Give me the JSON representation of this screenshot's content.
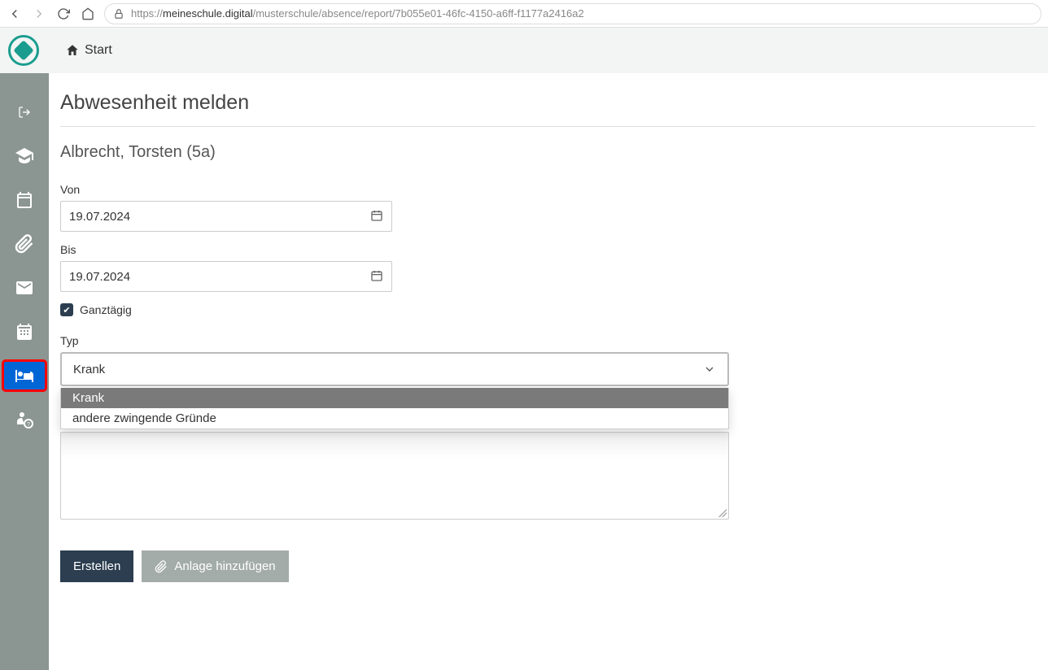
{
  "browser": {
    "url_prefix": "https://",
    "url_domain": "meineschule.digital",
    "url_path": "/musterschule/absence/report/7b055e01-46fc-4150-a6ff-f1177a2416a2"
  },
  "header": {
    "start": "Start"
  },
  "page": {
    "title": "Abwesenheit melden",
    "student": "Albrecht, Torsten (5a)"
  },
  "form": {
    "von_label": "Von",
    "von_value": "19.07.2024",
    "bis_label": "Bis",
    "bis_value": "19.07.2024",
    "allday_label": "Ganztägig",
    "allday_checked": true,
    "typ_label": "Typ",
    "typ_selected": "Krank",
    "typ_options": [
      "Krank",
      "andere zwingende Gründe"
    ]
  },
  "buttons": {
    "create": "Erstellen",
    "attach": "Anlage hinzufügen"
  },
  "sidebar": {
    "items": [
      {
        "name": "logout-icon"
      },
      {
        "name": "graduation-icon"
      },
      {
        "name": "calendar-icon"
      },
      {
        "name": "paperclip-icon"
      },
      {
        "name": "mail-icon"
      },
      {
        "name": "schedule-icon"
      },
      {
        "name": "bed-icon"
      },
      {
        "name": "person-help-icon"
      }
    ],
    "active_index": 6
  }
}
